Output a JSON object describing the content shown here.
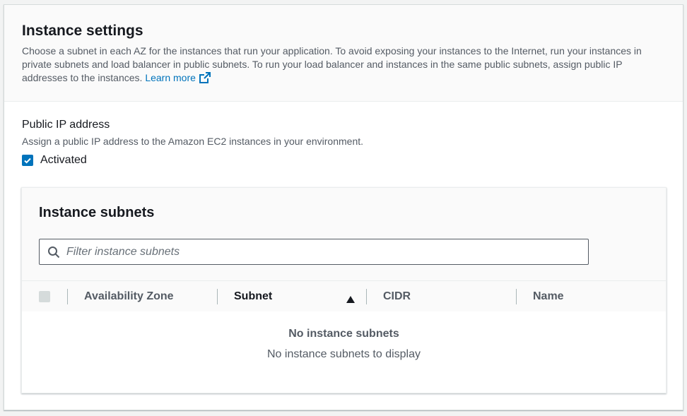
{
  "instance_settings": {
    "title": "Instance settings",
    "description": "Choose a subnet in each AZ for the instances that run your application. To avoid exposing your instances to the Internet, run your instances in private subnets and load balancer in public subnets. To run your load balancer and instances in the same public subnets, assign public IP addresses to the instances. ",
    "learn_more": "Learn more",
    "learn_more_icon": "external-link-icon"
  },
  "public_ip": {
    "label": "Public IP address",
    "description": "Assign a public IP address to the Amazon EC2 instances in your environment.",
    "checkbox_label": "Activated",
    "checked": true
  },
  "instance_subnets": {
    "title": "Instance subnets",
    "filter_placeholder": "Filter instance subnets",
    "columns": [
      "Availability Zone",
      "Subnet",
      "CIDR",
      "Name"
    ],
    "sorted_column": "Subnet",
    "sort_direction": "ascending",
    "empty_title": "No instance subnets",
    "empty_description": "No instance subnets to display"
  },
  "colors": {
    "accent": "#0073bb",
    "text": "#16191f",
    "muted": "#545b64"
  }
}
